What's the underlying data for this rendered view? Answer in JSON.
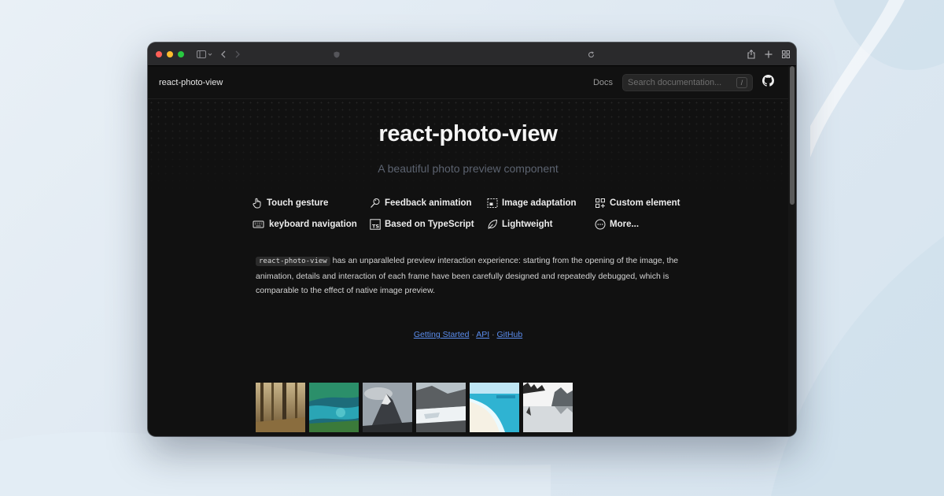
{
  "site": {
    "brand": "react-photo-view",
    "nav_docs": "Docs",
    "search_placeholder": "Search documentation...",
    "search_shortcut": "/"
  },
  "hero": {
    "title": "react-photo-view",
    "subtitle": "A beautiful photo preview component"
  },
  "features": [
    {
      "label": "Touch gesture",
      "icon": "touch-icon"
    },
    {
      "label": "Feedback animation",
      "icon": "magic-wand-icon"
    },
    {
      "label": "Image adaptation",
      "icon": "image-adapt-icon"
    },
    {
      "label": "Custom element",
      "icon": "grid-add-icon"
    },
    {
      "label": "keyboard navigation",
      "icon": "keyboard-icon"
    },
    {
      "label": "Based on TypeScript",
      "icon": "typescript-icon"
    },
    {
      "label": "Lightweight",
      "icon": "leaf-icon"
    },
    {
      "label": "More...",
      "icon": "more-icon"
    }
  ],
  "description": {
    "code": "react-photo-view",
    "text": " has an unparalleled preview interaction experience: starting from the opening of the image, the animation, details and interaction of each frame have been carefully designed and repeatedly debugged, which is comparable to the effect of native image preview."
  },
  "links": {
    "getting_started": "Getting Started",
    "api": "API",
    "github": "GitHub",
    "separator": "·"
  },
  "thumbnails": [
    {
      "name": "forest-photo"
    },
    {
      "name": "coast-photo"
    },
    {
      "name": "mountain-photo"
    },
    {
      "name": "glacier-photo"
    },
    {
      "name": "beach-photo"
    },
    {
      "name": "lake-photo"
    }
  ],
  "colors": {
    "accent_link": "#5b8dee",
    "page_bg": "#111111"
  }
}
